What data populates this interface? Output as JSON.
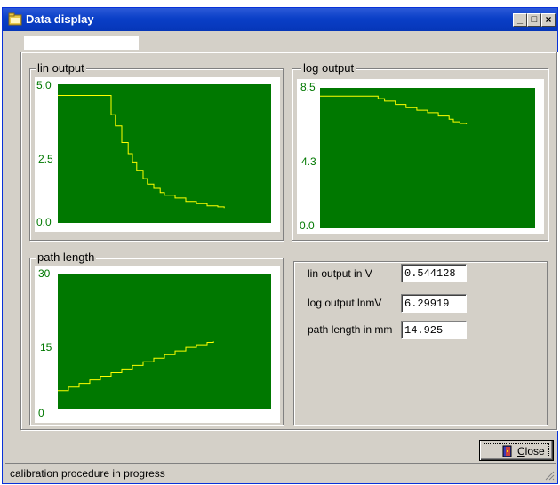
{
  "window": {
    "title": "Data display"
  },
  "titlebar_buttons": {
    "minimize": "_",
    "maximize": "□",
    "close": "×"
  },
  "groups": {
    "lin": {
      "label": "lin output"
    },
    "log": {
      "label": "log output"
    },
    "path": {
      "label": "path length"
    }
  },
  "readouts": [
    {
      "label": "lin output in V",
      "value": "0.544128"
    },
    {
      "label": "log output lnmV",
      "value": "6.29919"
    },
    {
      "label": "path length in mm",
      "value": "14.925"
    }
  ],
  "close_button": {
    "label": "Close",
    "accel": "C",
    "rest": "lose"
  },
  "status": {
    "text": "calibration procedure in progress"
  },
  "colors": {
    "plot_bg": "#007800",
    "trace": "#ffff00",
    "axis_text": "#007800"
  },
  "chart_data": [
    {
      "type": "line",
      "title": "lin output",
      "yticks": [
        "0.0",
        "2.5",
        "5.0"
      ],
      "ylim": [
        0,
        5.0
      ],
      "xlim": [
        0,
        100
      ],
      "grid": false,
      "series": [
        {
          "x": [
            0,
            20,
            23,
            25,
            27,
            28,
            30,
            33,
            35,
            37,
            40,
            42,
            45,
            48,
            50,
            55,
            60,
            65,
            70,
            75,
            78
          ],
          "y": [
            4.6,
            4.6,
            4.6,
            3.9,
            3.5,
            3.5,
            2.9,
            2.5,
            2.2,
            1.9,
            1.6,
            1.4,
            1.25,
            1.1,
            1.0,
            0.9,
            0.78,
            0.7,
            0.62,
            0.58,
            0.54
          ]
        }
      ]
    },
    {
      "type": "line",
      "title": "log output",
      "yticks": [
        "0.0",
        "4.3",
        "8.5"
      ],
      "ylim": [
        0,
        8.5
      ],
      "xlim": [
        0,
        100
      ],
      "grid": false,
      "series": [
        {
          "x": [
            0,
            10,
            20,
            25,
            27,
            30,
            35,
            40,
            45,
            50,
            55,
            60,
            62,
            65,
            68
          ],
          "y": [
            8.0,
            8.0,
            8.0,
            8.0,
            7.85,
            7.7,
            7.5,
            7.3,
            7.15,
            7.0,
            6.8,
            6.6,
            6.45,
            6.35,
            6.3
          ]
        }
      ]
    },
    {
      "type": "line",
      "title": "path length",
      "yticks": [
        "0",
        "15",
        "30"
      ],
      "ylim": [
        0,
        30
      ],
      "xlim": [
        0,
        100
      ],
      "grid": false,
      "series": [
        {
          "x": [
            0,
            5,
            10,
            15,
            20,
            25,
            30,
            35,
            40,
            45,
            50,
            55,
            60,
            65,
            70,
            73
          ],
          "y": [
            4.0,
            4.8,
            5.6,
            6.4,
            7.2,
            8.0,
            8.8,
            9.6,
            10.4,
            11.2,
            12.0,
            12.8,
            13.6,
            14.2,
            14.7,
            14.925
          ]
        }
      ]
    }
  ]
}
